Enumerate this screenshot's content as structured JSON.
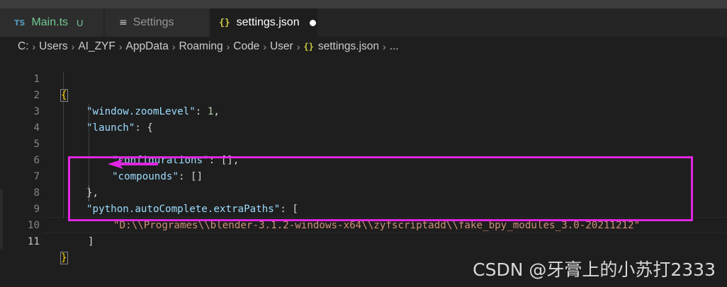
{
  "tabs": [
    {
      "icon": "TS",
      "label": "Main.ts",
      "badge": "U"
    },
    {
      "icon": "≡",
      "label": "Settings"
    },
    {
      "icon": "{}",
      "label": "settings.json",
      "dirty": true
    }
  ],
  "breadcrumb": {
    "segments": [
      "C:",
      "Users",
      "AI_ZYF",
      "AppData",
      "Roaming",
      "Code",
      "User"
    ],
    "file_icon": "{}",
    "file": "settings.json",
    "trailing": "..."
  },
  "editor": {
    "line_numbers": [
      "1",
      "2",
      "3",
      "4",
      "5",
      "6",
      "7",
      "8",
      "9",
      "10",
      "11"
    ],
    "lines": {
      "l1_open": "{",
      "l2_key": "\"window.zoomLevel\"",
      "l2_colon": ": ",
      "l2_value": "1",
      "l2_comma": ",",
      "l3_key": "\"launch\"",
      "l3_rest": ": {",
      "l5_key": "\"configurations\"",
      "l5_rest": ": [],",
      "l6_key": "\"compounds\"",
      "l6_rest": ": []",
      "l7_close": "},",
      "l8_key": "\"python.autoComplete.extraPaths\"",
      "l8_rest": ": [",
      "l9_value": "\"D:\\\\Programes\\\\blender-3.1.2-windows-x64\\\\zyfscriptadd\\\\fake_bpy_modules_3.0-20211212\"",
      "l10_close": "]",
      "l11_close": "}"
    },
    "active_line": 11
  },
  "annotation": {
    "box_color": "#e126e1",
    "arrow_color": "#e126e1"
  },
  "watermark": "CSDN @牙膏上的小苏打2333",
  "colors": {
    "background": "#1e1e1e",
    "tab_inactive": "#2d2d2d",
    "key": "#9cdcfe",
    "string": "#ce9178",
    "number": "#b5cea8",
    "bracket": "#ffd700"
  }
}
